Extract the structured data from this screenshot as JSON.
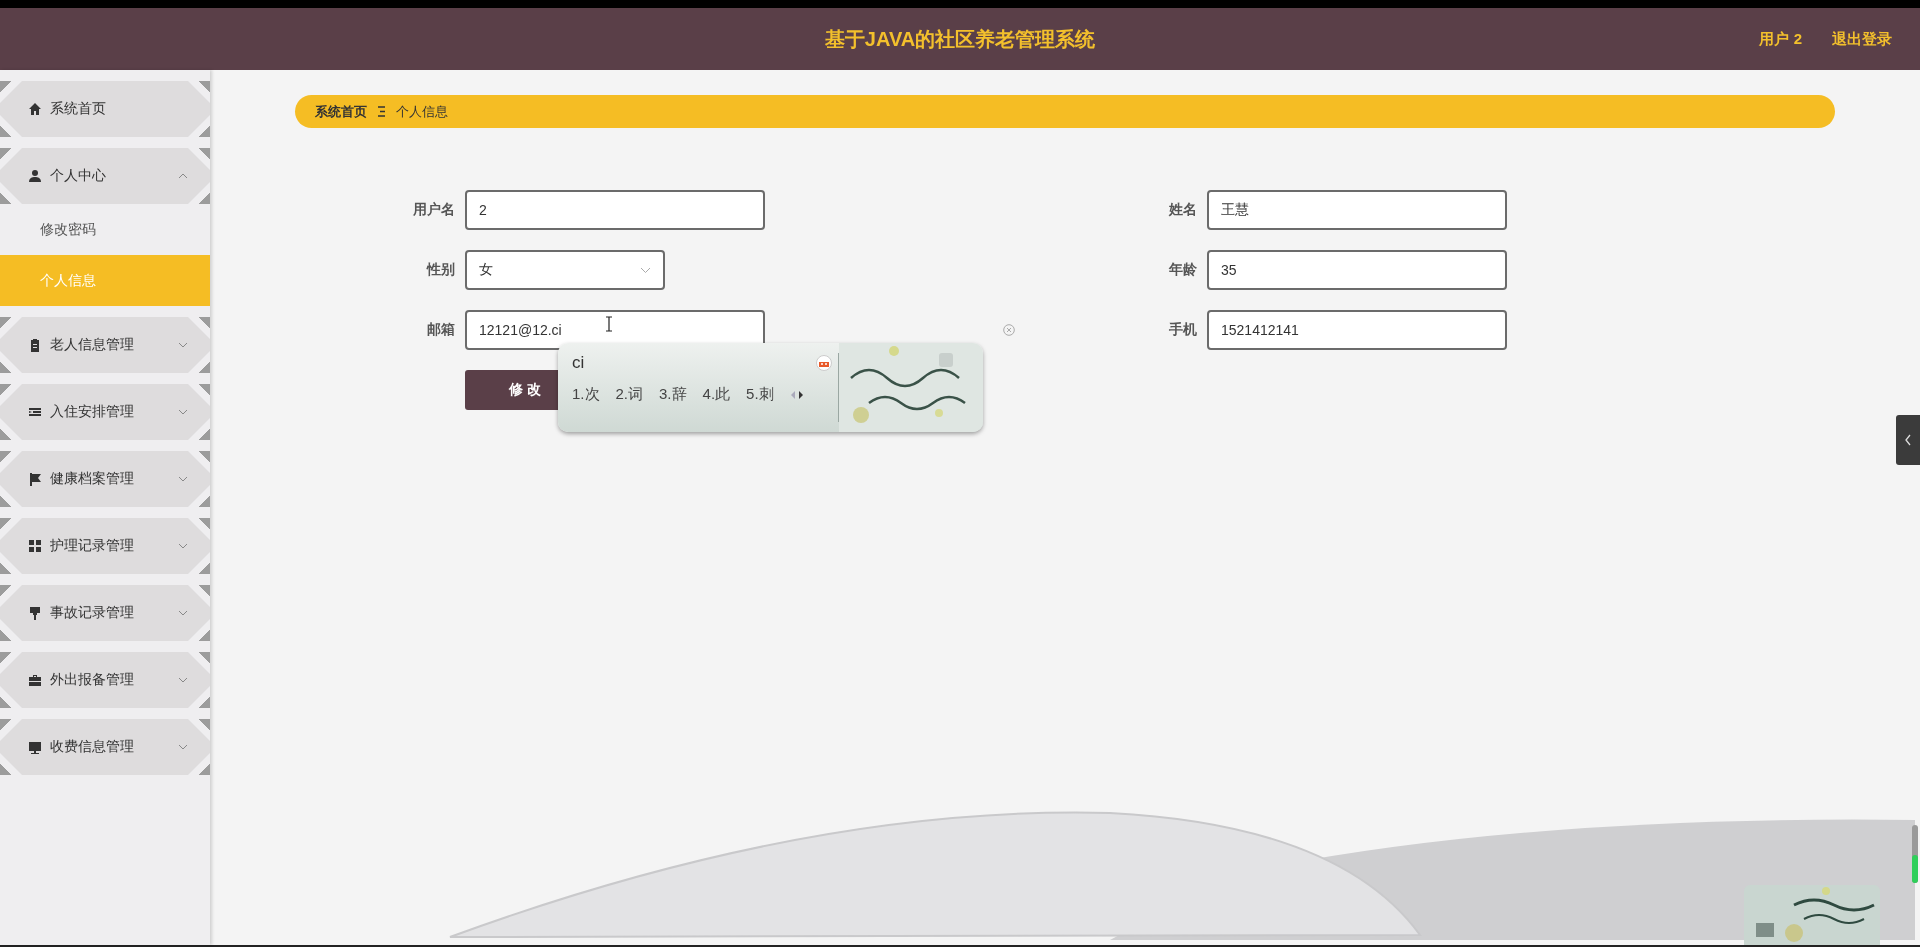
{
  "header": {
    "title": "基于JAVA的社区养老管理系统",
    "user": "用户 2",
    "logout": "退出登录"
  },
  "sidebar": {
    "items": [
      {
        "label": "系统首页",
        "kind": "link"
      },
      {
        "label": "个人中心",
        "kind": "menu",
        "expanded": true,
        "children": [
          {
            "label": "修改密码",
            "selected": false
          },
          {
            "label": "个人信息",
            "selected": true
          }
        ]
      },
      {
        "label": "老人信息管理",
        "kind": "menu",
        "expanded": false
      },
      {
        "label": "入住安排管理",
        "kind": "menu",
        "expanded": false
      },
      {
        "label": "健康档案管理",
        "kind": "menu",
        "expanded": false
      },
      {
        "label": "护理记录管理",
        "kind": "menu",
        "expanded": false
      },
      {
        "label": "事故记录管理",
        "kind": "menu",
        "expanded": false
      },
      {
        "label": "外出报备管理",
        "kind": "menu",
        "expanded": false
      },
      {
        "label": "收费信息管理",
        "kind": "menu",
        "expanded": false
      }
    ]
  },
  "breadcrumb": {
    "home": "系统首页",
    "current": "个人信息"
  },
  "form": {
    "rows": [
      {
        "left": {
          "label": "用户名",
          "value": "2",
          "kind": "text"
        },
        "right": {
          "label": "姓名",
          "value": "王慧",
          "kind": "text"
        }
      },
      {
        "left": {
          "label": "性别",
          "value": "女",
          "kind": "select"
        },
        "right": {
          "label": "年龄",
          "value": "35",
          "kind": "text"
        }
      },
      {
        "left": {
          "label": "邮箱",
          "value": "12121@12.ci",
          "kind": "text",
          "clearable": true
        },
        "right": {
          "label": "手机",
          "value": "1521412141",
          "kind": "text"
        }
      }
    ],
    "submit": "修 改"
  },
  "ime": {
    "input": "ci",
    "candidates": [
      "1.次",
      "2.词",
      "3.辞",
      "4.此",
      "5.刺"
    ]
  }
}
